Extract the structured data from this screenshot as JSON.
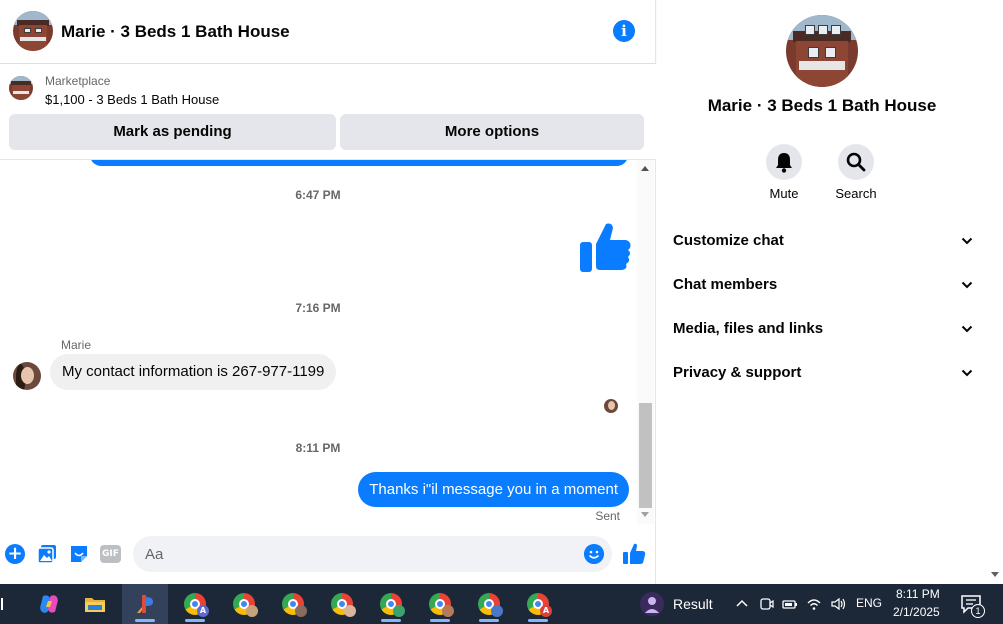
{
  "header": {
    "title": "Marie · 3 Beds 1 Bath House"
  },
  "listing": {
    "source": "Marketplace",
    "title": "$1,100 - 3 Beds 1 Bath House",
    "pending_label": "Mark as pending",
    "options_label": "More options"
  },
  "messages": {
    "timestamps": [
      "6:47 PM",
      "7:16 PM",
      "8:11 PM"
    ],
    "sender_name": "Marie",
    "incoming_text": "My contact information is 267-977-1199",
    "outgoing_text": "Thanks i\"il message you in a moment",
    "status": "Sent"
  },
  "composer": {
    "placeholder": "Aa",
    "gif_label": "GIF"
  },
  "info": {
    "name": "Marie · 3 Beds 1 Bath House",
    "actions": [
      {
        "label": "Mute",
        "icon": "bell-icon"
      },
      {
        "label": "Search",
        "icon": "search-icon"
      }
    ],
    "sections": [
      {
        "label": "Customize chat"
      },
      {
        "label": "Chat members"
      },
      {
        "label": "Media, files and links"
      },
      {
        "label": "Privacy & support"
      }
    ]
  },
  "taskbar": {
    "result_label": "Result",
    "language": "ENG",
    "time": "8:11 PM",
    "date": "2/1/2025",
    "notification_count": "1",
    "badges": [
      "A",
      "A"
    ]
  },
  "colors": {
    "accent": "#0a7cff",
    "bubble_incoming": "#f0f0f0",
    "button_gray": "#e4e6eb",
    "taskbar": "#1c2838"
  }
}
